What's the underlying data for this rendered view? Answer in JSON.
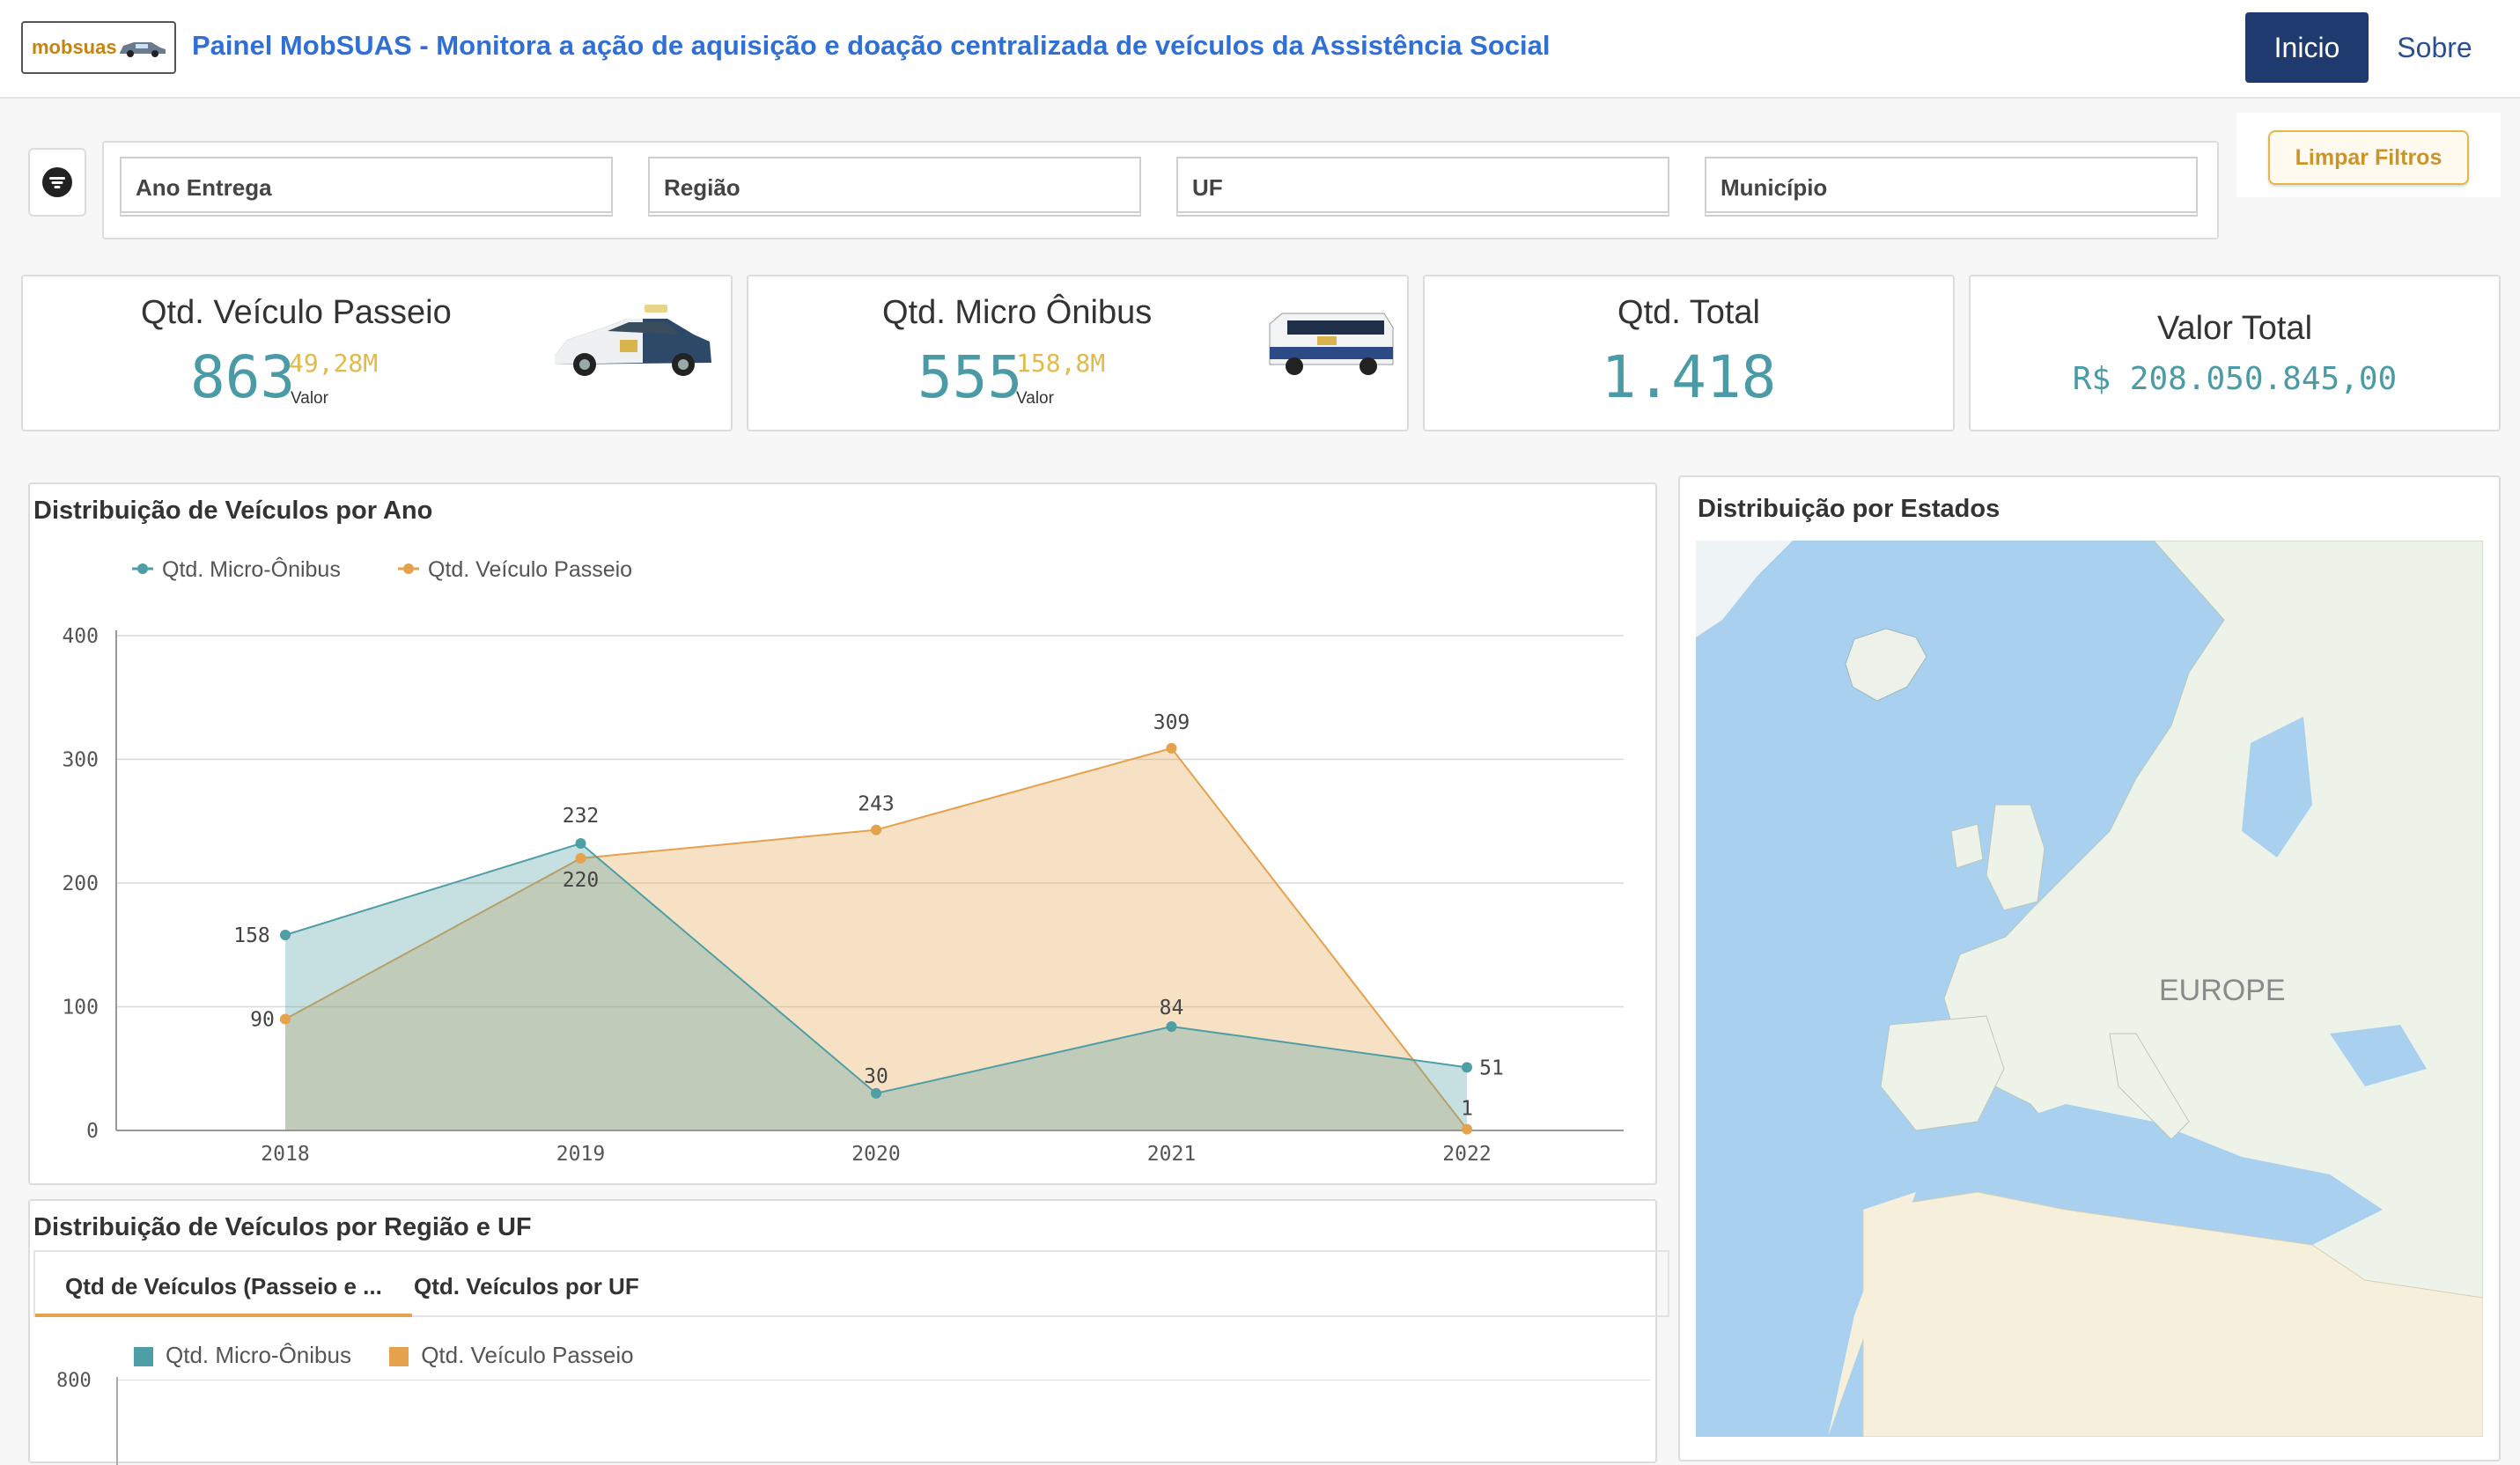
{
  "header": {
    "logo_text": "mobsuas",
    "title": "Painel MobSUAS - Monitora a ação de aquisição e doação centralizada de veículos da Assistência Social",
    "nav_inicio": "Inicio",
    "nav_sobre": "Sobre"
  },
  "filters": {
    "ano_entrega": "Ano Entrega",
    "regiao": "Região",
    "uf": "UF",
    "municipio": "Município",
    "clear_label": "Limpar Filtros"
  },
  "kpis": {
    "passeio": {
      "title": "Qtd. Veículo Passeio",
      "value": "863",
      "sub_value": "49,28M",
      "sub_label": "Valor"
    },
    "micro": {
      "title": "Qtd. Micro Ônibus",
      "value": "555",
      "sub_value": "158,8M",
      "sub_label": "Valor"
    },
    "total": {
      "title": "Qtd. Total",
      "value": "1.418"
    },
    "valor": {
      "title": "Valor Total",
      "value": "R$ 208.050.845,00"
    }
  },
  "colors": {
    "teal": "#4e9ea5",
    "orange": "#e5a14c",
    "nav_blue": "#1f3a6e",
    "title_blue": "#2f6fd6",
    "kpi_teal": "#4a9ba6",
    "kpi_gold": "#e2b94b"
  },
  "chart_panel": {
    "title": "Distribuição de Veículos por Ano"
  },
  "chart_data": {
    "type": "area",
    "x": [
      "2018",
      "2019",
      "2020",
      "2021",
      "2022"
    ],
    "series": [
      {
        "name": "Qtd. Micro-Ônibus",
        "values": [
          158,
          232,
          30,
          84,
          51
        ],
        "color": "#4e9ea5"
      },
      {
        "name": "Qtd. Veículo Passeio",
        "values": [
          90,
          220,
          243,
          309,
          1
        ],
        "color": "#e5a14c"
      }
    ],
    "yticks": [
      "0",
      "100",
      "200",
      "300",
      "400"
    ],
    "ylim": [
      0,
      400
    ],
    "legend": "top-left",
    "grid": true
  },
  "region_panel": {
    "title": "Distribuição de Veículos por Região e UF",
    "tabs": [
      "Qtd de Veículos (Passeio e ...",
      "Qtd. Veículos por UF"
    ],
    "legend": [
      "Qtd. Micro-Ônibus",
      "Qtd. Veículo Passeio"
    ],
    "y_top_tick": "800"
  },
  "map_panel": {
    "title": "Distribuição por Estados",
    "map_label": "EUROPE"
  }
}
